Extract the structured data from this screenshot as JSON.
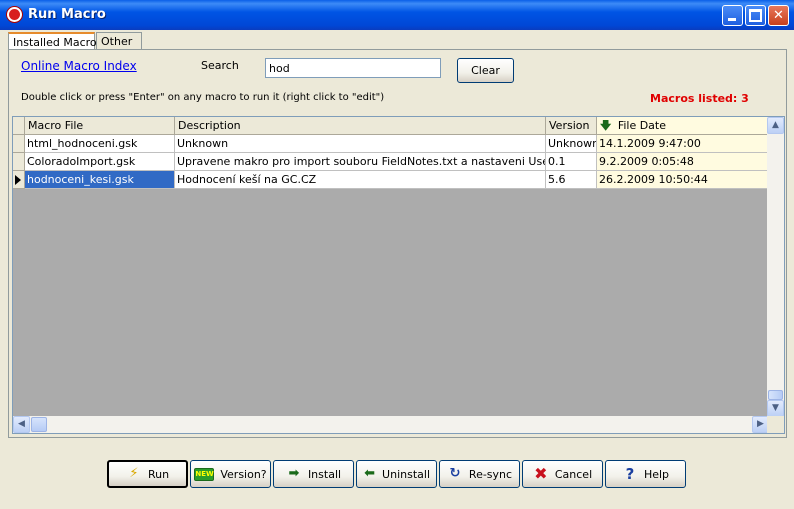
{
  "window": {
    "title": "Run Macro"
  },
  "tabs": [
    {
      "label": "Installed Macros",
      "active": true
    },
    {
      "label": "Other",
      "active": false
    }
  ],
  "top": {
    "link_label": "Online Macro Index",
    "search_label": "Search",
    "search_value": "hod",
    "clear_label": "Clear",
    "hint": "Double click or press \"Enter\" on any macro to run it (right click to \"edit\")",
    "count_label": "Macros listed: 3"
  },
  "table": {
    "columns": [
      "Macro File",
      "Description",
      "Version",
      "File Date"
    ],
    "sort_icon": "sort-down-arrow-icon",
    "rows": [
      {
        "file": "html_hodnoceni.gsk",
        "description": "Unknown",
        "version": "Unknown",
        "date": "14.1.2009 9:47:00"
      },
      {
        "file": "ColoradoImport.gsk",
        "description": "Upravene makro pro import souboru FieldNotes.txt a nastaveni UserFlag (Makr",
        "version": "0.1",
        "date": "9.2.2009 0:05:48"
      },
      {
        "file": "hodnoceni_kesi.gsk",
        "description": "Hodnocení keší na GC.CZ",
        "version": "5.6",
        "date": "26.2.2009 10:50:44"
      }
    ],
    "selected_row": 2
  },
  "buttons": [
    {
      "label": "Run",
      "icon": "lightning-icon",
      "glyph": "⚡"
    },
    {
      "label": "Version?",
      "icon": "new-badge-icon",
      "glyph": "NEW"
    },
    {
      "label": "Install",
      "icon": "arrow-right-icon",
      "glyph": "➡"
    },
    {
      "label": "Uninstall",
      "icon": "arrow-left-icon",
      "glyph": "⬅"
    },
    {
      "label": "Re-sync",
      "icon": "refresh-icon",
      "glyph": "↻"
    },
    {
      "label": "Cancel",
      "icon": "cancel-x-icon",
      "glyph": "✖"
    },
    {
      "label": "Help",
      "icon": "question-icon",
      "glyph": "?"
    }
  ],
  "colors": {
    "accent": "#316ac5",
    "count": "#e00000",
    "link": "#0000ee"
  }
}
